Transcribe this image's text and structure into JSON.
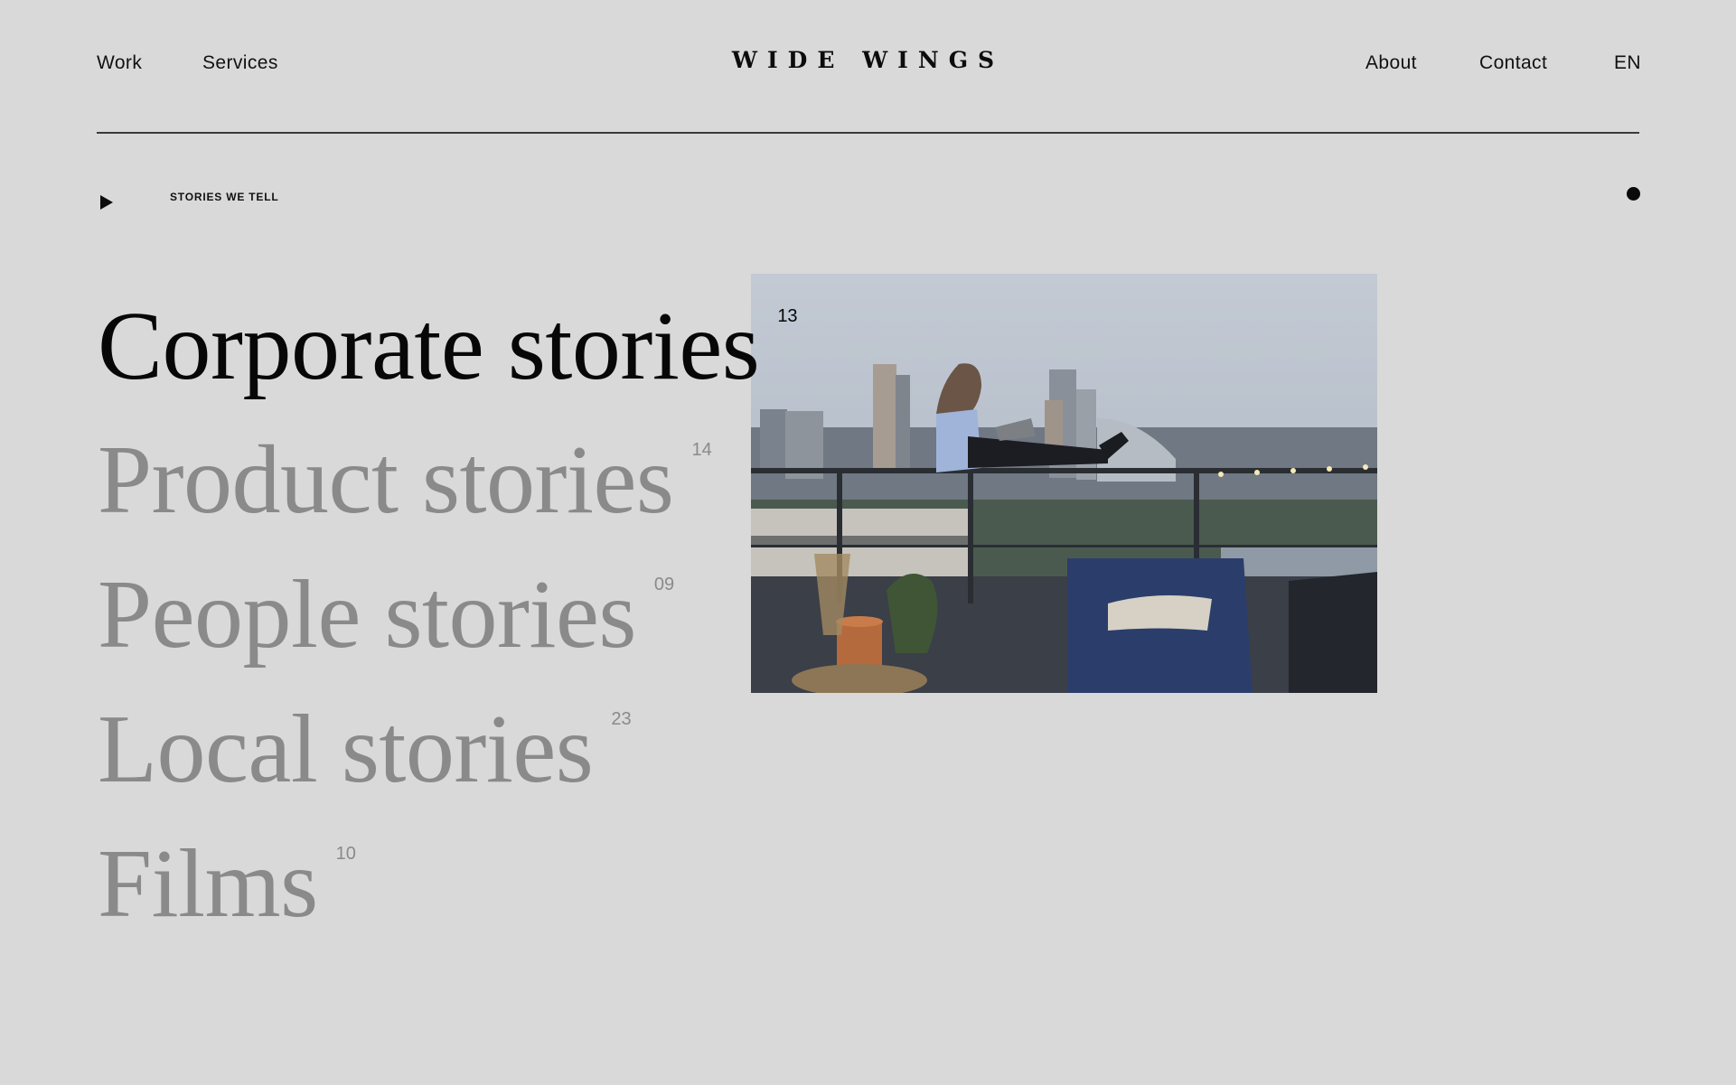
{
  "header": {
    "left_nav": [
      {
        "label": "Work"
      },
      {
        "label": "Services"
      }
    ],
    "logo": "WIDE WINGS",
    "right_nav": [
      {
        "label": "About"
      },
      {
        "label": "Contact"
      },
      {
        "label": "EN"
      }
    ]
  },
  "section": {
    "label": "STORIES WE TELL",
    "play_icon": "play-icon",
    "indicator_icon": "dot-icon"
  },
  "stories": [
    {
      "title": "Corporate stories",
      "count": "13",
      "active": true
    },
    {
      "title": "Product stories",
      "count": "14",
      "active": false
    },
    {
      "title": "People stories",
      "count": "09",
      "active": false
    },
    {
      "title": "Local stories",
      "count": "23",
      "active": false
    },
    {
      "title": "Films",
      "count": "10",
      "active": false
    }
  ],
  "colors": {
    "background": "#d9d9d9",
    "active_text": "#070707",
    "inactive_text": "#8a8a8a"
  }
}
